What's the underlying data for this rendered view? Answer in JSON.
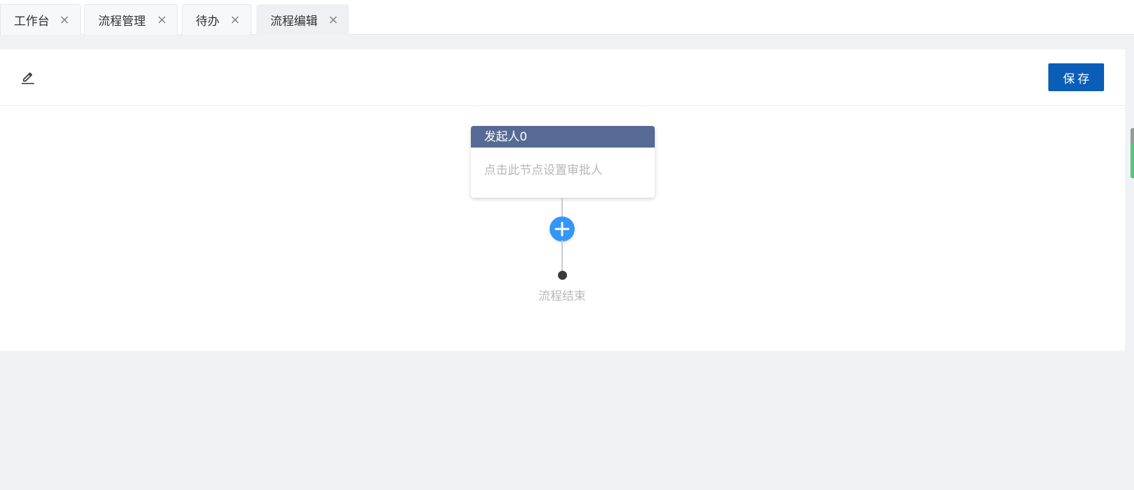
{
  "tabs": [
    {
      "label": "工作台",
      "active": false
    },
    {
      "label": "流程管理",
      "active": false
    },
    {
      "label": "待办",
      "active": false
    },
    {
      "label": "流程编辑",
      "active": true
    }
  ],
  "toolbar": {
    "edit_icon": "pencil-icon",
    "save_label": "保存"
  },
  "flow": {
    "start_node": {
      "title": "发起人0",
      "placeholder": "点击此节点设置审批人"
    },
    "add_icon": "plus-icon",
    "end_label": "流程结束"
  },
  "colors": {
    "save_button": "#0b5eb8",
    "node_header": "#576a95",
    "add_button": "#3296fa",
    "page_background": "#f0f2f5"
  }
}
